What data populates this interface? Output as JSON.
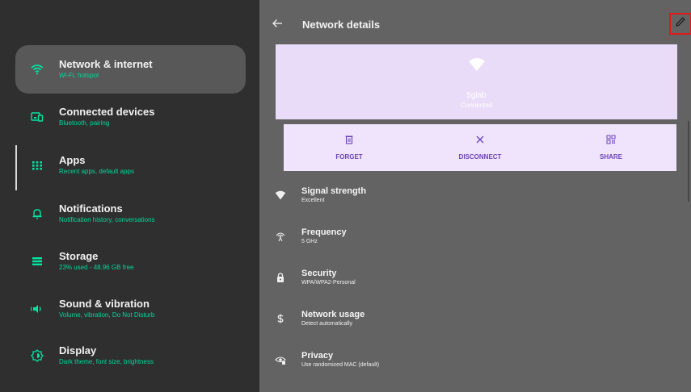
{
  "sidebar": {
    "items": [
      {
        "title": "Network & internet",
        "subtitle": "Wi-Fi, hotspot",
        "icon": "wifi-icon",
        "active": true
      },
      {
        "title": "Connected devices",
        "subtitle": "Bluetooth, pairing",
        "icon": "devices-icon"
      },
      {
        "title": "Apps",
        "subtitle": "Recent apps, default apps",
        "icon": "apps-grid-icon"
      },
      {
        "title": "Notifications",
        "subtitle": "Notification history, conversations",
        "icon": "bell-icon"
      },
      {
        "title": "Storage",
        "subtitle": "23% used - 48.96 GB free",
        "icon": "storage-icon"
      },
      {
        "title": "Sound & vibration",
        "subtitle": "Volume, vibration, Do Not Disturb",
        "icon": "speaker-icon"
      },
      {
        "title": "Display",
        "subtitle": "Dark theme, font size, brightness",
        "icon": "brightness-icon"
      }
    ]
  },
  "header": {
    "title": "Network details",
    "back_icon": "back-arrow-icon",
    "edit_icon": "pencil-icon"
  },
  "network": {
    "name": "5glab",
    "status": "Connected"
  },
  "actions": [
    {
      "label": "FORGET",
      "icon": "trash-icon"
    },
    {
      "label": "DISCONNECT",
      "icon": "close-icon"
    },
    {
      "label": "SHARE",
      "icon": "qr-code-icon"
    }
  ],
  "details": [
    {
      "title": "Signal strength",
      "value": "Excellent",
      "icon": "wifi-filled-icon"
    },
    {
      "title": "Frequency",
      "value": "5 GHz",
      "icon": "antenna-icon"
    },
    {
      "title": "Security",
      "value": "WPA/WPA2-Personal",
      "icon": "lock-icon"
    },
    {
      "title": "Network usage",
      "value": "Detect automatically",
      "icon": "dollar-icon"
    },
    {
      "title": "Privacy",
      "value": "Use randomized MAC (default)",
      "icon": "privacy-icon"
    }
  ],
  "colors": {
    "accent": "#00e6a0",
    "panel": "#636363",
    "sidebar": "#2f2f2f",
    "hero": "#e9dcf8",
    "action_text": "#6e43b9"
  }
}
